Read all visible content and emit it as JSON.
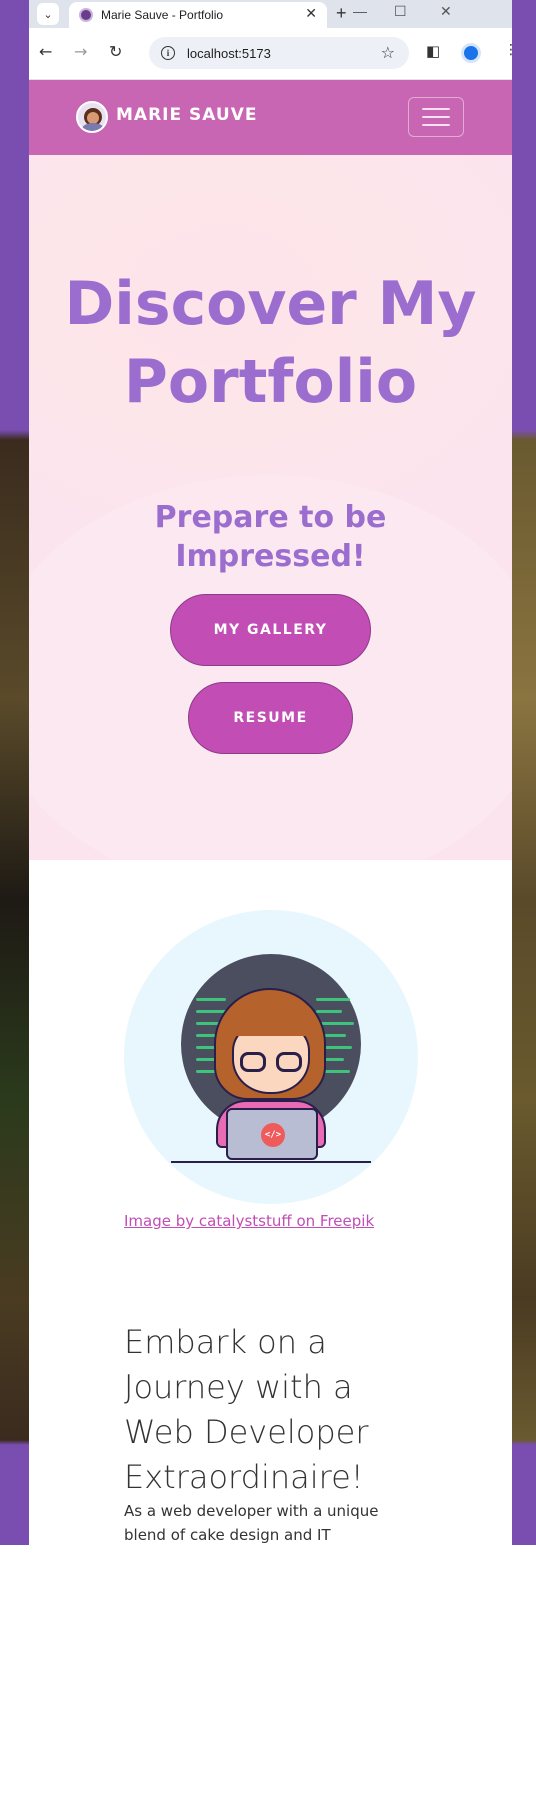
{
  "browser": {
    "tab_title": "Marie Sauve - Portfolio",
    "tab_close": "✕",
    "new_tab": "+",
    "url": "localhost:5173",
    "window_controls": {
      "minimize": "—",
      "maximize": "☐",
      "close": "✕"
    }
  },
  "navbar": {
    "brand": "MARIE SAUVE",
    "menu_icon": "hamburger-menu-icon"
  },
  "hero": {
    "title": "Discover My Portfolio",
    "subtitle": "Prepare to be Impressed!",
    "gallery_button": "MY GALLERY",
    "resume_button": "RESUME"
  },
  "illustration": {
    "badge": "</>",
    "credit": "Image by catalyststuff on Freepik"
  },
  "about": {
    "title": "Embark on a Journey with a Web Developer Extraordinaire!",
    "text": "As a web developer with a unique blend of cake design and IT administration"
  },
  "colors": {
    "navbar": "#c866b3",
    "hero_text": "#9a6dce",
    "button": "#c14db5",
    "desktop": "#6f47a6"
  }
}
